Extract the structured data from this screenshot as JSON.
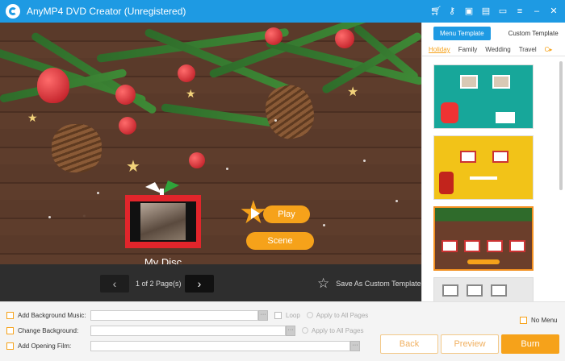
{
  "window": {
    "title": "AnyMP4 DVD Creator (Unregistered)",
    "icons": [
      "cart-icon",
      "key-icon",
      "save-icon",
      "register-icon",
      "feedback-icon",
      "menu-icon",
      "minimize-icon",
      "close-icon"
    ]
  },
  "preview": {
    "disc_title": "My Disc",
    "play_label": "Play",
    "scene_label": "Scene"
  },
  "pager": {
    "prev": "‹",
    "next": "›",
    "page_text": "1 of 2 Page(s)",
    "save_template": "Save As Custom Template"
  },
  "templates": {
    "tabs": [
      "Menu Template",
      "Custom Template"
    ],
    "categories": [
      "Holiday",
      "Family",
      "Wedding",
      "Travel"
    ],
    "more": "C▸"
  },
  "options": {
    "background_music": "Add Background Music:",
    "loop": "Loop",
    "apply_all_1": "Apply to All Pages",
    "change_background": "Change Background:",
    "apply_all_2": "Apply to All Pages",
    "opening_film": "Add Opening Film:",
    "dots": "···",
    "no_menu": "No Menu"
  },
  "actions": {
    "back": "Back",
    "preview": "Preview",
    "burn": "Burn"
  },
  "colors": {
    "titlebar": "#1e9ae3",
    "accent": "#f6a21a",
    "frame_red": "#e2252b"
  }
}
